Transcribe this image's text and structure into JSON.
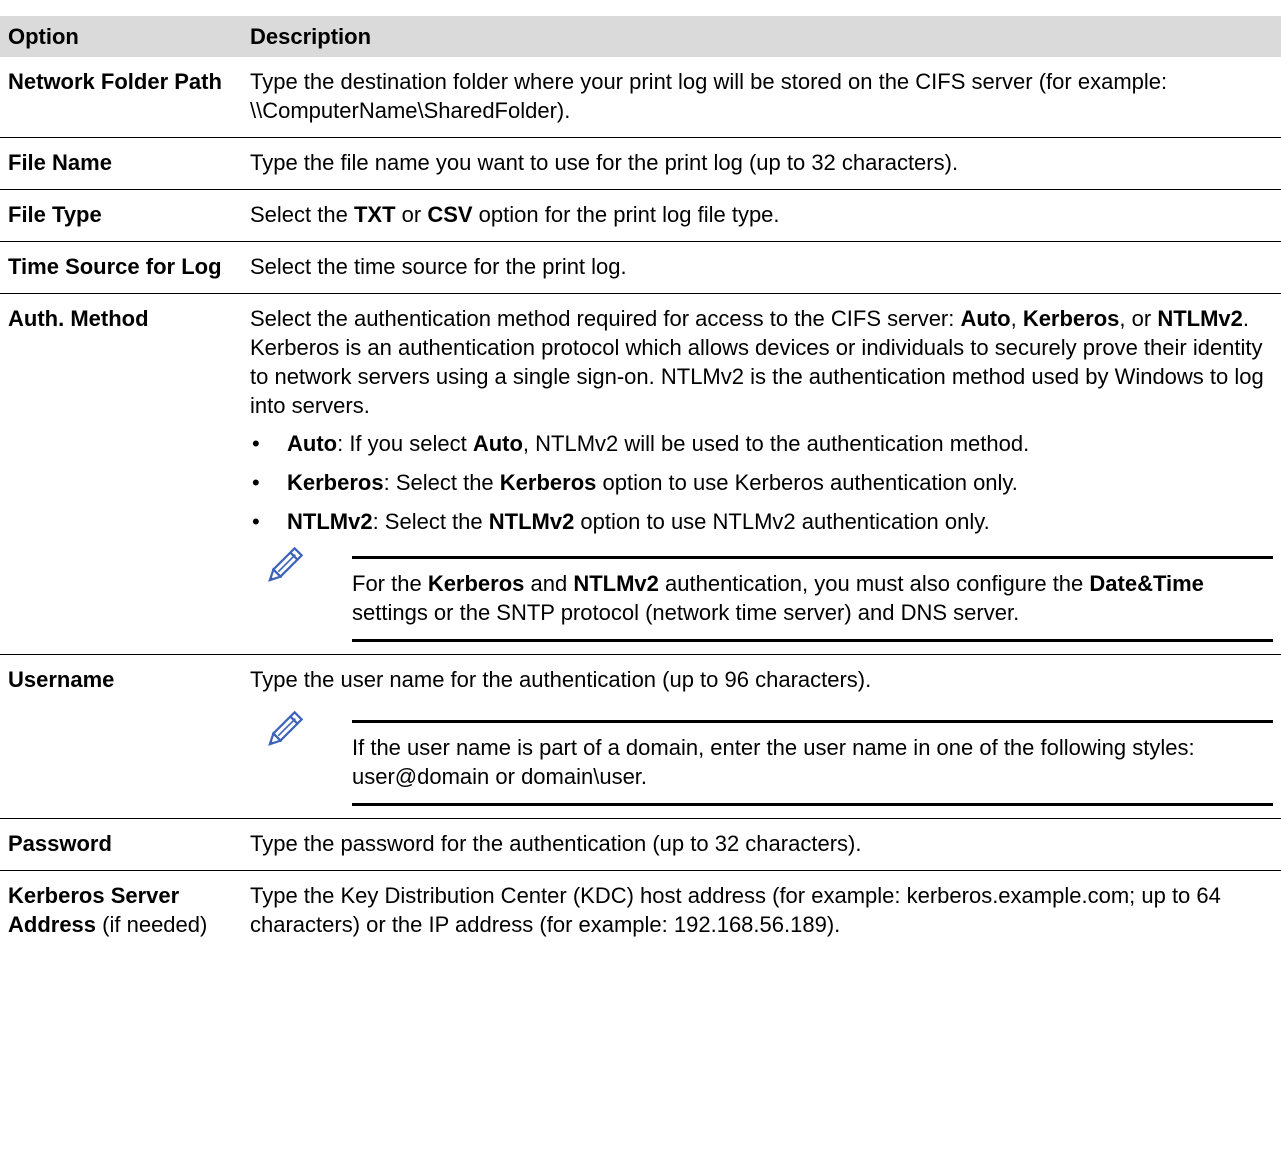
{
  "headers": {
    "option": "Option",
    "description": "Description"
  },
  "rows": {
    "network_folder_path": {
      "option": "Network Folder Path",
      "desc": "Type the destination folder where your print log will be stored on the CIFS server (for example: \\\\ComputerName\\SharedFolder)."
    },
    "file_name": {
      "option": "File Name",
      "desc": "Type the file name you want to use for the print log (up to 32 characters)."
    },
    "file_type": {
      "option": "File Type",
      "desc_a": "Select the ",
      "txt": "TXT",
      "desc_b": " or ",
      "csv": "CSV",
      "desc_c": " option for the print log file type."
    },
    "time_source": {
      "option": "Time Source for Log",
      "desc": "Select the time source for the print log."
    },
    "auth_method": {
      "option": "Auth. Method",
      "p1": "Select the authentication method required for access to the CIFS server: ",
      "auto": "Auto",
      "p2": ", ",
      "kerberos": "Kerberos",
      "p3": ", or ",
      "ntlmv2": "NTLMv2",
      "p4": ". Kerberos is an authentication protocol which allows devices or individuals to securely prove their identity to network servers using a single sign-on. NTLMv2 is the authentication method used by Windows to log into servers.",
      "bullet_char": "•",
      "b1_term": "Auto",
      "b1_a": ": If you select ",
      "b1_b": "Auto",
      "b1_c": ", NTLMv2 will be used to the authentication method.",
      "b2_term": "Kerberos",
      "b2_a": ": Select the ",
      "b2_b": "Kerberos",
      "b2_c": " option to use Kerberos authentication only.",
      "b3_term": "NTLMv2",
      "b3_a": ": Select the ",
      "b3_b": "NTLMv2",
      "b3_c": " option to use NTLMv2 authentication only.",
      "note_a": "For the ",
      "note_kerberos": "Kerberos",
      "note_b": " and ",
      "note_ntlmv2": "NTLMv2",
      "note_c": " authentication, you must also configure the ",
      "note_datetime": "Date&Time",
      "note_d": " settings or the SNTP protocol (network time server) and DNS server."
    },
    "username": {
      "option": "Username",
      "desc": "Type the user name for the authentication (up to 96 characters).",
      "note": "If the user name is part of a domain, enter the user name in one of the following styles: user@domain or domain\\user."
    },
    "password": {
      "option": "Password",
      "desc": "Type the password for the authentication (up to 32 characters)."
    },
    "kerberos_server": {
      "option_bold": "Kerberos Server Address",
      "option_normal": " (if needed)",
      "desc": "Type the Key Distribution Center (KDC) host address (for example: kerberos.example.com; up to 64 characters) or the IP address (for example: 192.168.56.189)."
    }
  },
  "icons": {
    "note": "pencil-note-icon"
  },
  "colors": {
    "header_bg": "#dadada",
    "note_icon": "#3b63b8"
  }
}
